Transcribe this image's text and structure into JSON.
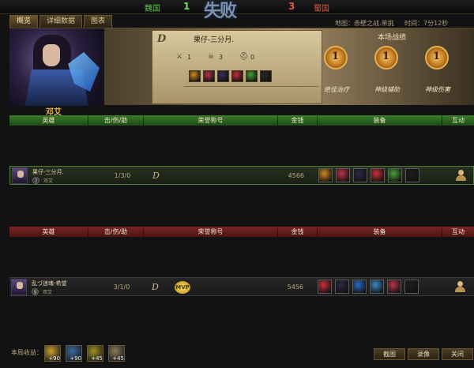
{
  "scoreboard": {
    "left_faction": "魏国",
    "left_score": "1",
    "result_text": "失败",
    "right_score": "3",
    "right_faction": "蜀国"
  },
  "tabs": [
    "概览",
    "详细数据",
    "图表"
  ],
  "map_info": "地图：赤壁之战.单挑",
  "time_info": "时间：7分12秒",
  "hero_panel": {
    "rank": "D",
    "player_name": "果仔-三分月.",
    "stats": [
      {
        "icon": "crossed-swords-icon",
        "value": "1"
      },
      {
        "icon": "skull-icon",
        "value": "3"
      },
      {
        "icon": "helmet-icon",
        "value": "0"
      }
    ],
    "item_colors": [
      "#d08a20",
      "#b8334a",
      "#3a2a5a",
      "#c8303a",
      "#4aa03a",
      "#2a2a2a"
    ],
    "battle_title": "本场战绩",
    "medals": [
      {
        "num": "1",
        "label": "绝佳治疗"
      },
      {
        "num": "1",
        "label": "神级辅助"
      },
      {
        "num": "1",
        "label": "神级伤害"
      }
    ],
    "hero_name": "邓艾"
  },
  "headers": {
    "hero": "英雄",
    "kda": "击/伤/助",
    "title": "荣誉称号",
    "gold": "金钱",
    "equip": "装备",
    "action": "互动"
  },
  "ally_rows": [
    {
      "player": "果仔-三分月.",
      "level": "7",
      "hero": "邓艾",
      "kda": "1/3/0",
      "rank": "D",
      "honor": "",
      "gold": "4566",
      "items": [
        "#d08a20",
        "#b8334a",
        "#2a2a44",
        "#c8303a",
        "#4aa03a",
        "#1e1e1e"
      ]
    }
  ],
  "enemy_rows": [
    {
      "player": "乱づ迷魂-希望",
      "level": "9",
      "hero": "邓艾",
      "kda": "3/1/0",
      "rank": "D",
      "honor": "MVP",
      "gold": "5456",
      "items": [
        "#c8303a",
        "#2a2a44",
        "#2a6ac8",
        "#3a8ac0",
        "#b8334a",
        "#1e1e1e"
      ]
    }
  ],
  "footer": {
    "label": "本局收益：",
    "rewards": [
      {
        "icon": "gold-icon",
        "amount": "+90",
        "color": "#c8a030"
      },
      {
        "icon": "exp-icon",
        "amount": "+90",
        "color": "#3a6aa0"
      },
      {
        "icon": "honor-icon",
        "amount": "+45",
        "color": "#a09020"
      },
      {
        "icon": "skill-icon",
        "amount": "+45",
        "color": "#8a7a5a"
      }
    ],
    "buttons": {
      "screenshot": "截图",
      "record": "录像",
      "close": "关闭"
    }
  }
}
